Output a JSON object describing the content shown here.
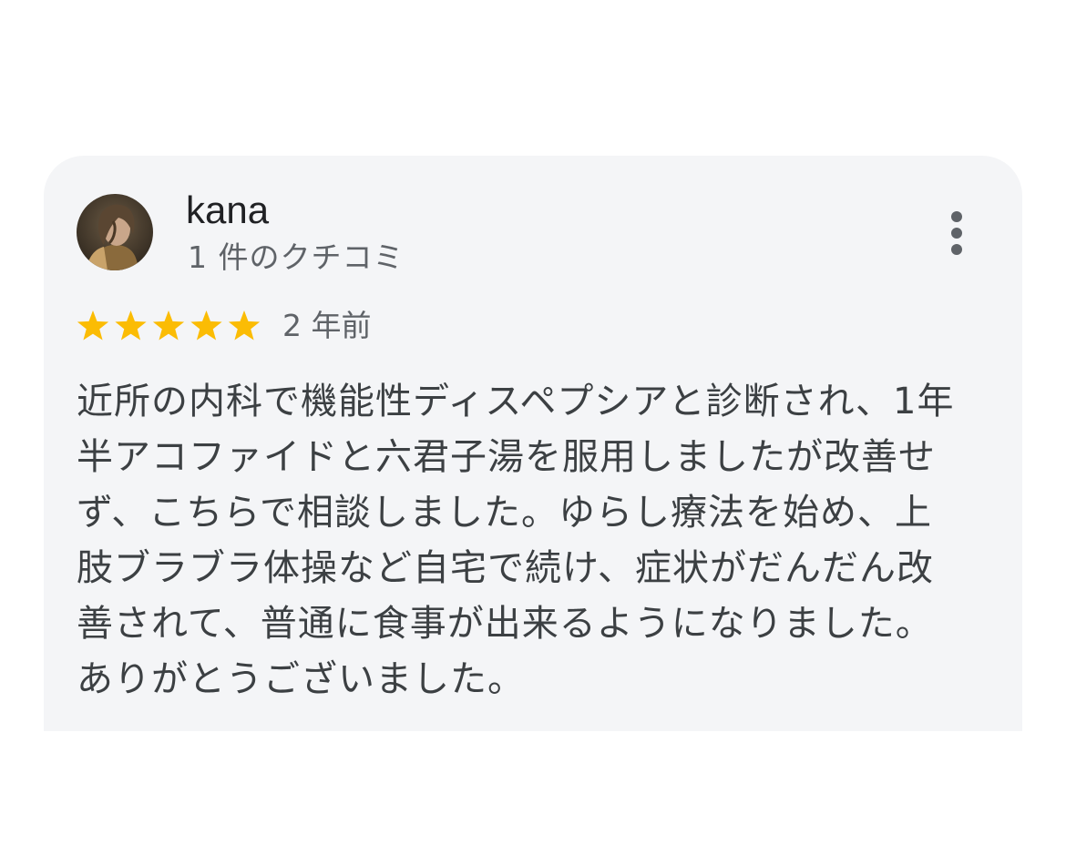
{
  "review": {
    "reviewer_name": "kana",
    "review_count": "1 件のクチコミ",
    "rating": 5,
    "rating_max": 5,
    "time_ago": "2 年前",
    "text_lines": [
      "近所の内科で機能性ディスペプシアと診断され、1年",
      "半アコファイドと六君子湯を服用しましたが改善せ",
      "ず、こちらで相談しました。ゆらし療法を始め、上",
      "肢ブラブラ体操など自宅で続け、症状がだんだん改",
      "善されて、普通に食事が出来るようになりました。",
      "ありがとうございました。"
    ]
  },
  "icons": {
    "more": "more-vert-icon",
    "star": "star-icon"
  },
  "colors": {
    "card_background": "#f4f5f7",
    "star": "#fbbc04",
    "primary_text": "#202124",
    "secondary_text": "#5f6368",
    "body_text": "#3c4043"
  }
}
